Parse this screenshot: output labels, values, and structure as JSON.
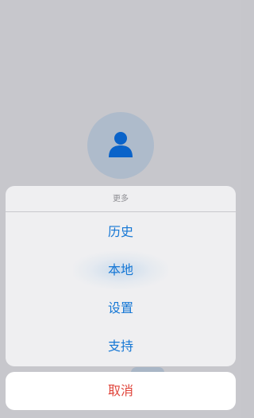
{
  "sheet": {
    "title": "更多",
    "items": [
      {
        "label": "历史"
      },
      {
        "label": "本地"
      },
      {
        "label": "设置"
      },
      {
        "label": "支持"
      }
    ],
    "cancel_label": "取消"
  },
  "icons": {
    "avatar": "person-icon"
  },
  "colors": {
    "accent": "#1577d5",
    "cancel": "#e0443a",
    "backdrop": "#c7c7cc",
    "avatar_bg": "#aebbcb"
  }
}
